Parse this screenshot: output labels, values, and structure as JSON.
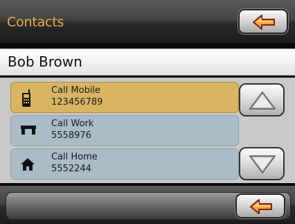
{
  "header": {
    "title": "Contacts",
    "back_icon": "back-arrow-icon"
  },
  "contact": {
    "name": "Bob Brown"
  },
  "actions": [
    {
      "label": "Call Mobile",
      "number": "123456789",
      "icon": "mobile-phone-icon",
      "selected": true
    },
    {
      "label": "Call Work",
      "number": "5558976",
      "icon": "work-desk-icon",
      "selected": false
    },
    {
      "label": "Call Home",
      "number": "5552244",
      "icon": "home-icon",
      "selected": false
    }
  ],
  "scroll": {
    "up_icon": "scroll-up-icon",
    "down_icon": "scroll-down-icon"
  },
  "colors": {
    "title": "#e8b24a",
    "selected_row": "#d9b463",
    "row": "#a9bcc7",
    "arrow_fill": "#e8a23a"
  }
}
